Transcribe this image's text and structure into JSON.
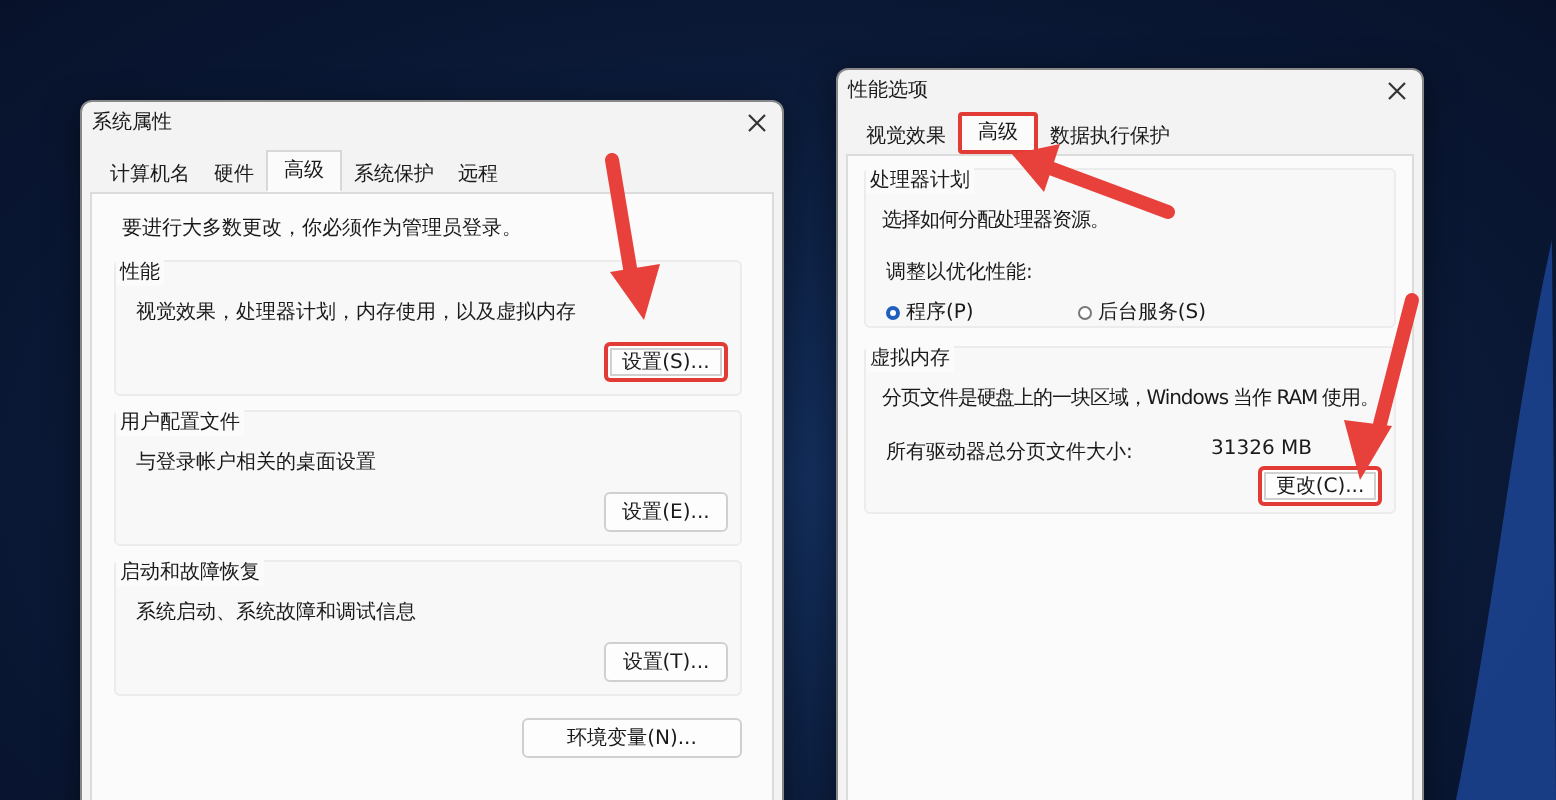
{
  "left_window": {
    "title": "系统属性",
    "tabs": [
      {
        "label": "计算机名",
        "selected": false,
        "highlighted": false
      },
      {
        "label": "硬件",
        "selected": false,
        "highlighted": false
      },
      {
        "label": "高级",
        "selected": true,
        "highlighted": false
      },
      {
        "label": "系统保护",
        "selected": false,
        "highlighted": false
      },
      {
        "label": "远程",
        "selected": false,
        "highlighted": false
      }
    ],
    "notice": "要进行大多数更改，你必须作为管理员登录。",
    "groups": [
      {
        "title": "性能",
        "description": "视觉效果，处理器计划，内存使用，以及虚拟内存",
        "button": {
          "label": "设置(S)...",
          "highlighted": true
        }
      },
      {
        "title": "用户配置文件",
        "description": "与登录帐户相关的桌面设置",
        "button": {
          "label": "设置(E)...",
          "highlighted": false
        }
      },
      {
        "title": "启动和故障恢复",
        "description": "系统启动、系统故障和调试信息",
        "button": {
          "label": "设置(T)...",
          "highlighted": false
        }
      }
    ],
    "footer_button": {
      "label": "环境变量(N)...",
      "highlighted": false
    }
  },
  "right_window": {
    "title": "性能选项",
    "tabs": [
      {
        "label": "视觉效果",
        "selected": false,
        "highlighted": false
      },
      {
        "label": "高级",
        "selected": true,
        "highlighted": true
      },
      {
        "label": "数据执行保护",
        "selected": false,
        "highlighted": false
      }
    ],
    "processor_group": {
      "title": "处理器计划",
      "description": "选择如何分配处理器资源。",
      "prompt": "调整以优化性能:",
      "options": [
        {
          "label": "程序(P)",
          "selected": true
        },
        {
          "label": "后台服务(S)",
          "selected": false
        }
      ]
    },
    "virtual_memory_group": {
      "title": "虚拟内存",
      "description": "分页文件是硬盘上的一块区域，Windows 当作 RAM 使用。",
      "total_label": "所有驱动器总分页文件大小:",
      "total_value": "31326 MB",
      "button": {
        "label": "更改(C)...",
        "highlighted": true
      }
    }
  }
}
